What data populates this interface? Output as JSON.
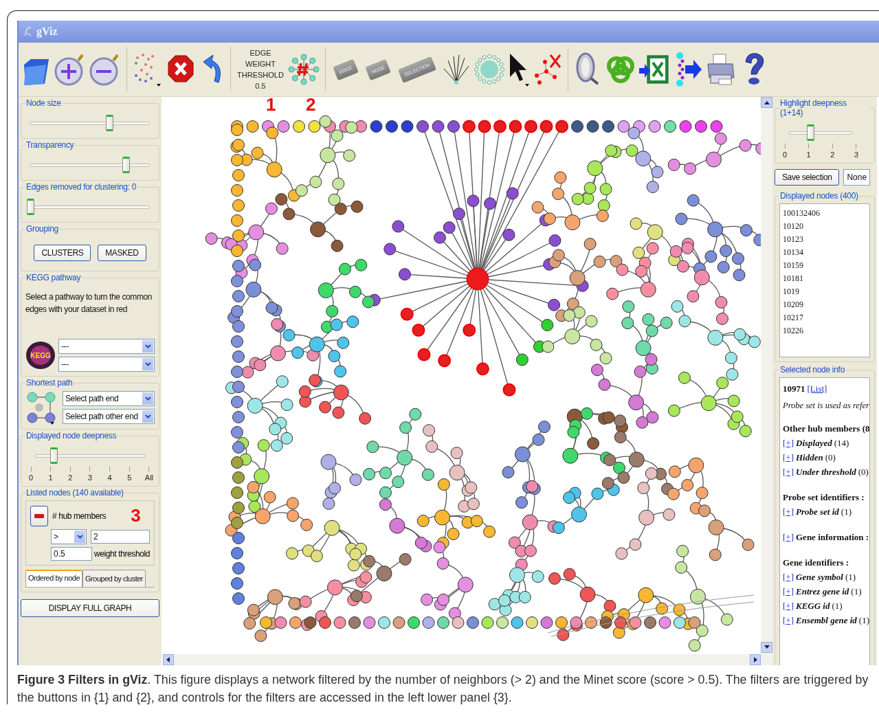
{
  "window": {
    "title": "gViz"
  },
  "toolbar": {
    "threshold_label": "EDGE WEIGHT THRESHOLD",
    "threshold_value": "0.5",
    "tags": [
      "EDGE",
      "NODE",
      "SELECTION"
    ]
  },
  "callouts": [
    "1",
    "2",
    "3"
  ],
  "left_panel": {
    "node_size": {
      "title": "Node size",
      "level": 0.66
    },
    "transparency": {
      "title": "Transparency",
      "level": 0.8
    },
    "edges_removed": {
      "title": "Edges removed for clustering: 0",
      "level": 0
    },
    "grouping": {
      "title": "Grouping",
      "buttons": [
        "CLUSTERS",
        "MASKED"
      ]
    },
    "kegg": {
      "title": "KEGG pathway",
      "description": "Select a pathway to turn the common edges with your dataset in red",
      "logo_text": "KEGG",
      "dropdowns": [
        "---",
        "---"
      ]
    },
    "shortest_path": {
      "title": "Shortest path",
      "dropdowns": [
        "Select path end",
        "Select path other end"
      ]
    },
    "deepness": {
      "title": "Displayed node deepness",
      "level": 0.167,
      "ticks": [
        "0",
        "1",
        "2",
        "3",
        "4",
        "5",
        "All"
      ]
    },
    "listed_nodes": {
      "title": "Listed nodes (140 available)",
      "filter_label": "# hub members",
      "operator": ">",
      "value": "2",
      "threshold": "0.5",
      "threshold_label": "weight threshold",
      "tabs": [
        {
          "label": "Ordered by node",
          "selected": true
        },
        {
          "label": "Grouped by cluster",
          "selected": false
        }
      ]
    },
    "display_button": "DISPLAY FULL GRAPH"
  },
  "right_panel": {
    "highlight": {
      "title": "Highlight deepness (1+14)",
      "level": 0.333,
      "ticks": [
        "0",
        "1",
        "2",
        "3"
      ]
    },
    "save_button": "Save selection",
    "selection_dropdown": "None",
    "displayed_nodes": {
      "title": "Displayed nodes (400)",
      "items": [
        "100132406",
        "10120",
        "10123",
        "10134",
        "10159",
        "10181",
        "1019",
        "10209",
        "10217",
        "10226"
      ]
    },
    "node_info": {
      "title": "Selected node info",
      "node_id": "10971",
      "link": "[List]",
      "note": "Probe set is used as refer",
      "sections": [
        {
          "heading": "Other hub members (8",
          "items": [
            {
              "toggle": "[+]",
              "name": "Displayed",
              "count": "(14)",
              "kind": "italic"
            },
            {
              "toggle": "[+]",
              "name": "Hidden",
              "count": "(0)",
              "kind": "italic"
            },
            {
              "toggle": "[+]",
              "name": "Under threshold",
              "count": "(0)",
              "kind": "italic"
            }
          ]
        },
        {
          "heading": "Probe set identifiers :",
          "items": [
            {
              "toggle": "[+]",
              "name": "Probe set id",
              "count": "(1)",
              "kind": "italic"
            }
          ]
        },
        {
          "items": [
            {
              "toggle": "[+]",
              "name": "Gene information :",
              "kind": "bold"
            }
          ]
        },
        {
          "heading": "Gene identifiers :",
          "items": [
            {
              "toggle": "[+]",
              "name": "Gene symbol",
              "count": "(1)",
              "kind": "italic"
            },
            {
              "toggle": "[+]",
              "name": "Entrez gene id",
              "count": "(1)",
              "kind": "italic"
            },
            {
              "toggle": "[+]",
              "name": "KEGG id",
              "count": "(1)",
              "kind": "italic"
            },
            {
              "toggle": "[+]",
              "name": "Ensembl gene id",
              "count": "(1)",
              "kind": "italic"
            }
          ]
        }
      ]
    }
  },
  "caption": "**Figure 3 Filters in gViz**. This figure displays a network filtered by the number of neighbors (> 2) and the Minet score (score > 0.5). The filters are triggered by the buttons in {1} and {2}, and controls for the filters are accessed in the left lower panel {3}."
}
